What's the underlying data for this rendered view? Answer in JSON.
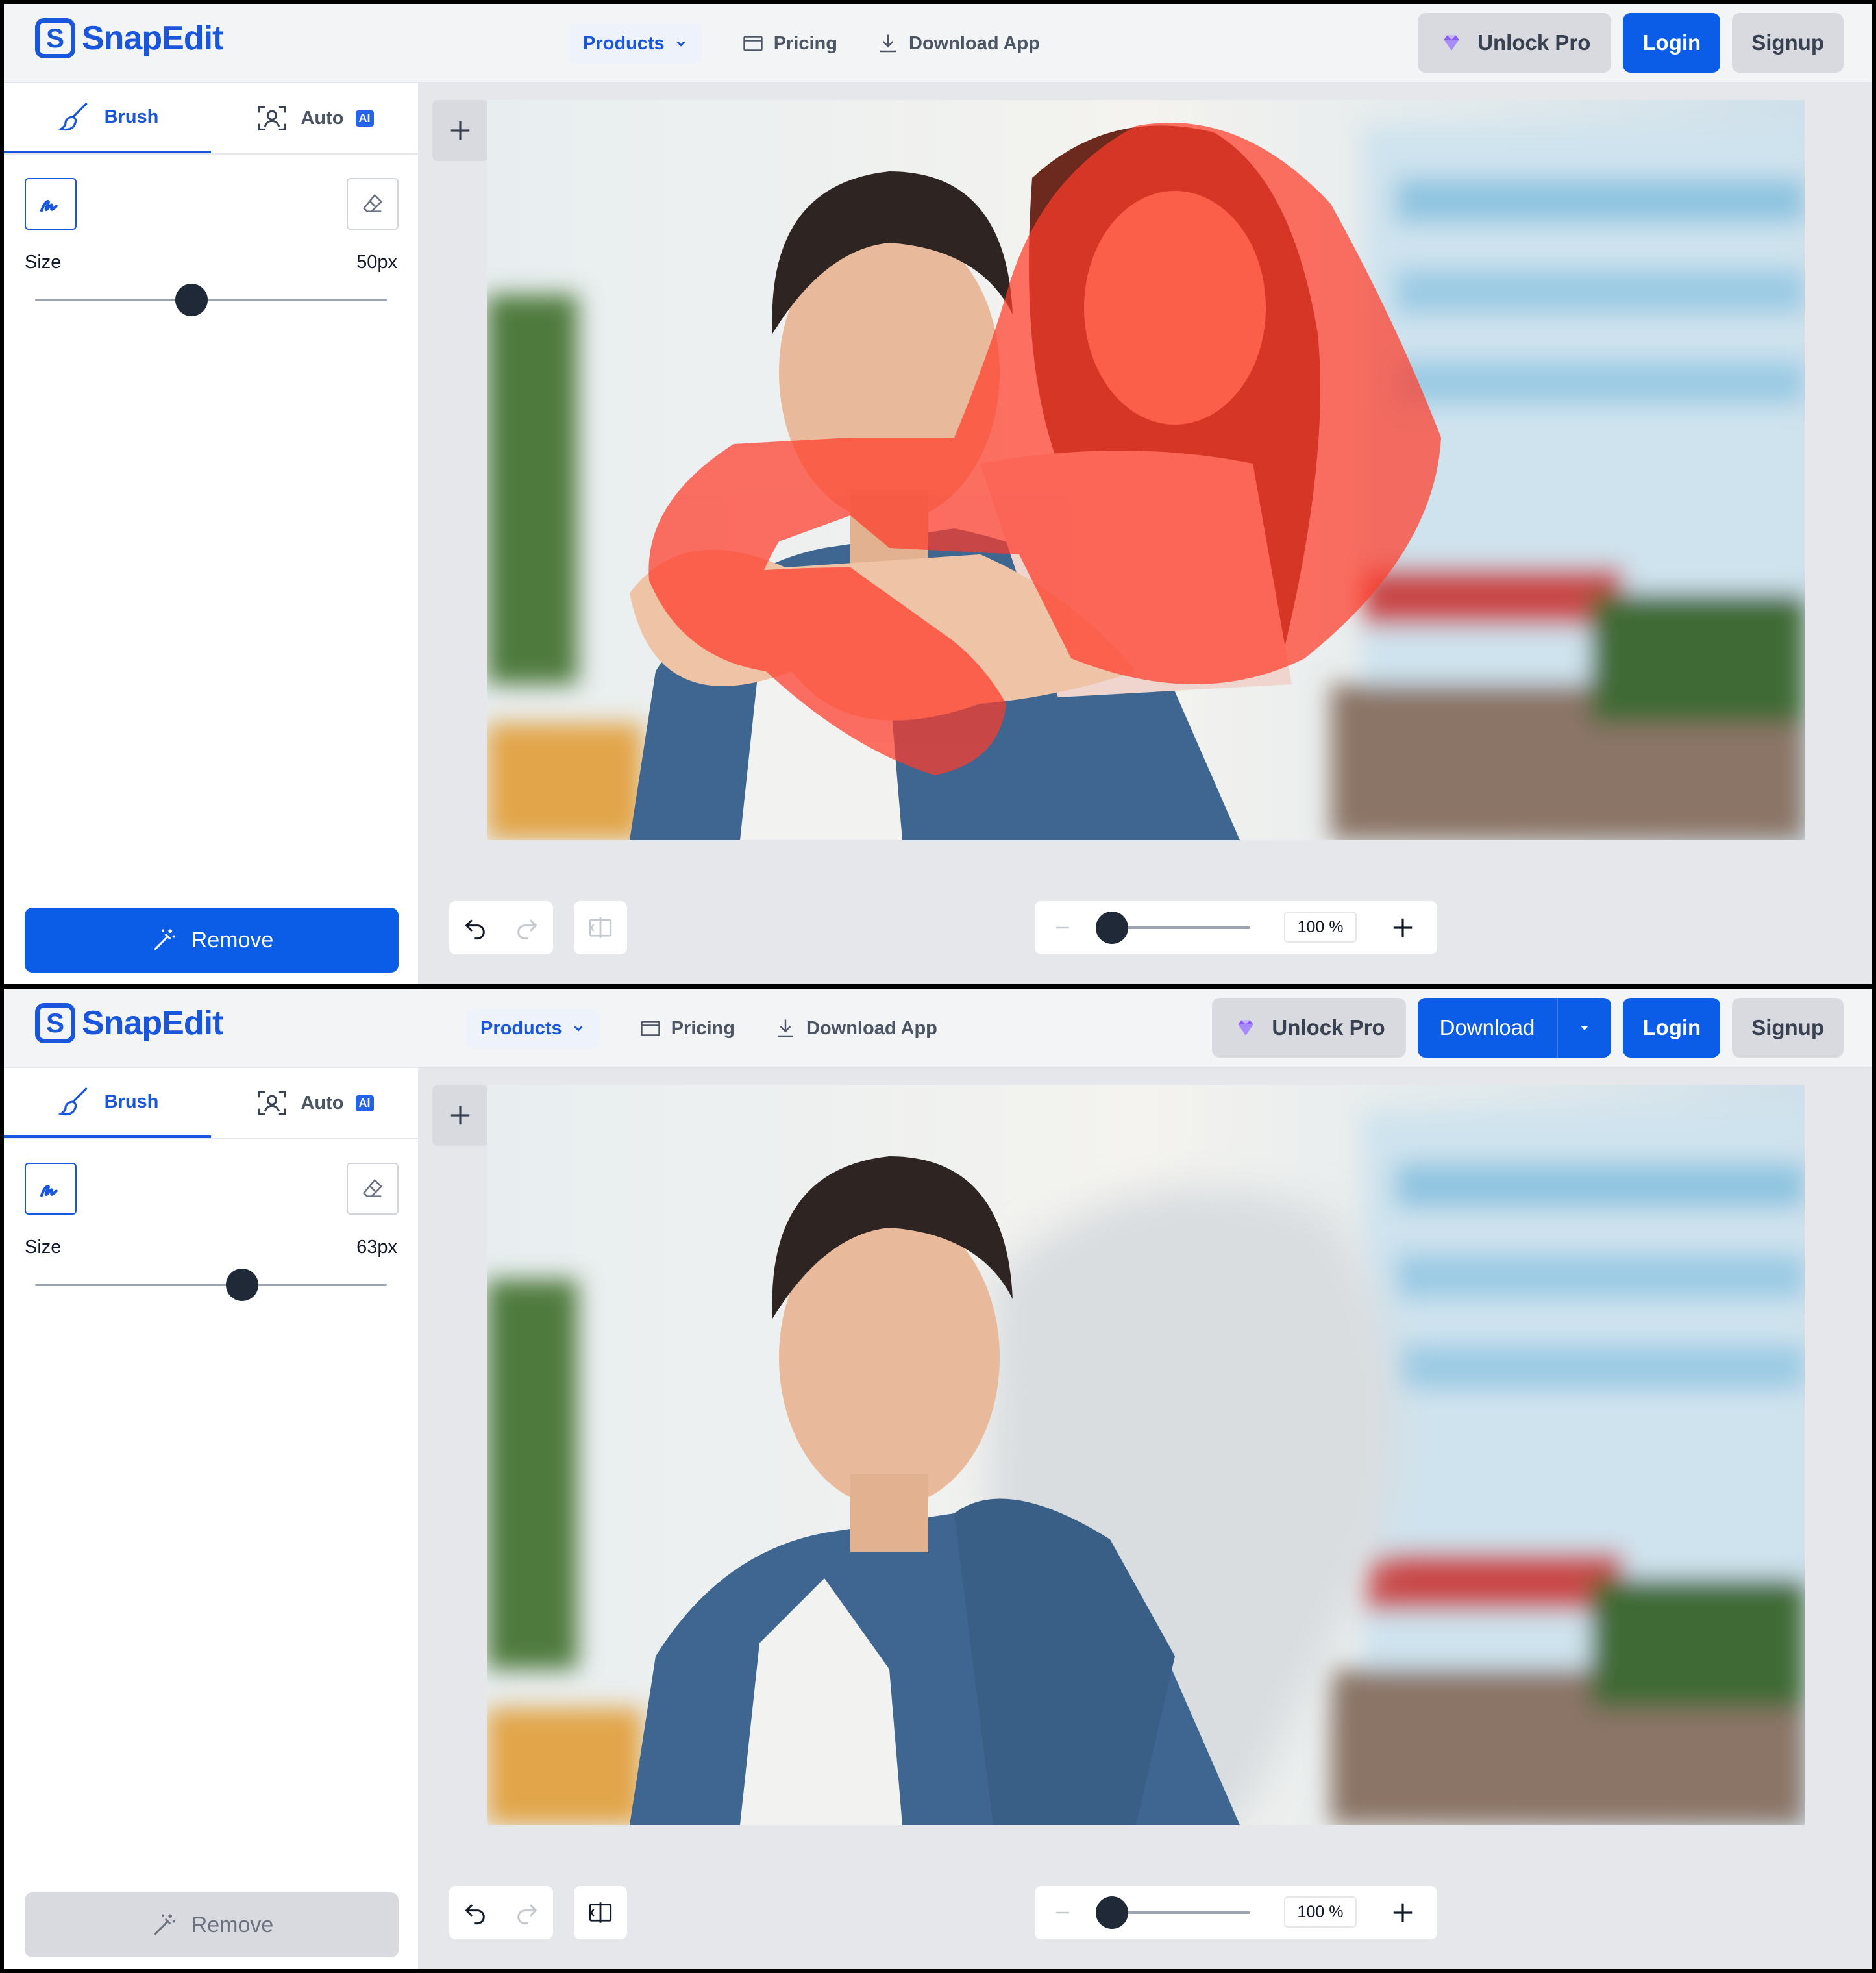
{
  "app": {
    "logo_glyph": "S",
    "logo_text": "SnapEdit",
    "brand_color": "#1a56db"
  },
  "nav": {
    "products": "Products",
    "pricing": "Pricing",
    "download_app": "Download App"
  },
  "header": {
    "unlock_pro": "Unlock Pro",
    "download": "Download",
    "login": "Login",
    "signup": "Signup"
  },
  "sidebar": {
    "tab_brush": "Brush",
    "tab_auto": "Auto",
    "ai_badge": "AI",
    "size_label": "Size",
    "remove": "Remove"
  },
  "panels": [
    {
      "size_value": "50px",
      "brush_size_fraction": 0.44,
      "remove_enabled": true,
      "mask_visible": true,
      "download_visible": false
    },
    {
      "size_value": "63px",
      "brush_size_fraction": 0.58,
      "remove_enabled": false,
      "mask_visible": false,
      "download_visible": true
    }
  ],
  "canvas": {
    "zoom": "100 %",
    "zoom_fraction": 0.0
  },
  "icons": {
    "logo": "snapedit-logo-icon",
    "products": "chevron-down-icon",
    "pricing": "pricing-card-icon",
    "download_app": "download-icon",
    "pro": "gem-icon",
    "brush": "brush-icon",
    "auto": "face-scan-icon",
    "draw": "draw-pen-icon",
    "eraser": "eraser-icon",
    "remove": "magic-wand-icon",
    "add": "plus-icon",
    "undo": "undo-icon",
    "redo": "redo-icon",
    "compare": "compare-icon",
    "zoom_out": "minus-icon",
    "zoom_in": "plus-icon"
  }
}
